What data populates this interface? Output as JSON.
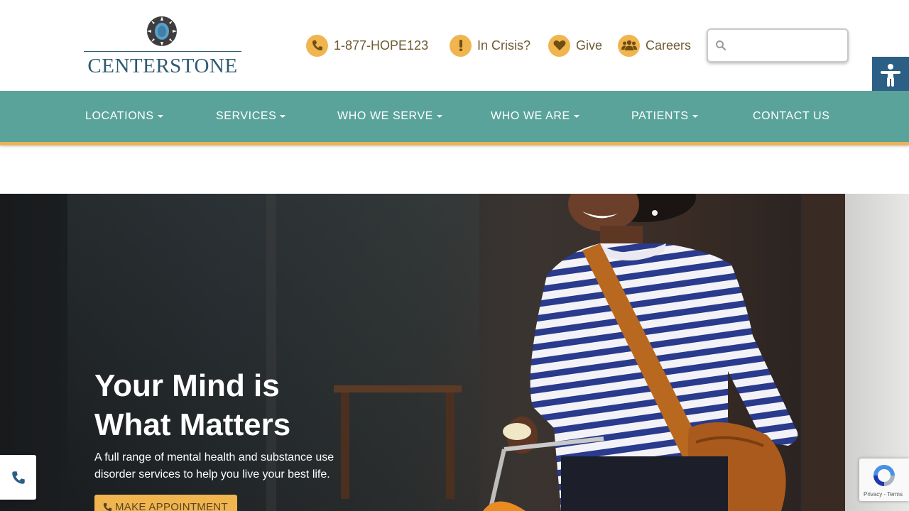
{
  "brand": {
    "name": "CENTERSTONE"
  },
  "utility": {
    "phone": "1-877-HOPE123",
    "crisis": "In Crisis?",
    "give": "Give",
    "careers": "Careers"
  },
  "search": {
    "placeholder": "",
    "value": ""
  },
  "nav": {
    "items": [
      {
        "label": "LOCATIONS"
      },
      {
        "label": "SERVICES"
      },
      {
        "label": "WHO WE SERVE"
      },
      {
        "label": "WHO WE ARE"
      },
      {
        "label": "PATIENTS"
      },
      {
        "label": "CONTACT US"
      }
    ]
  },
  "hero": {
    "headline_line1": "Your Mind is",
    "headline_line2": "What Matters",
    "lead_line1": "A full range of mental health and substance use",
    "lead_line2": "disorder services to help you live your best life.",
    "cta_label": "MAKE APPOINTMENT"
  },
  "recaptcha": {
    "links": "Privacy - Terms"
  },
  "colors": {
    "nav_bg": "#5aa39a",
    "accent_gold": "#f0b54f",
    "brand_blue": "#2f5b73",
    "a11y_blue": "#2b5f86"
  },
  "icons": [
    "phone-icon",
    "alert-icon",
    "heart-icon",
    "group-icon",
    "search-icon",
    "accessibility-icon",
    "recaptcha-icon"
  ]
}
